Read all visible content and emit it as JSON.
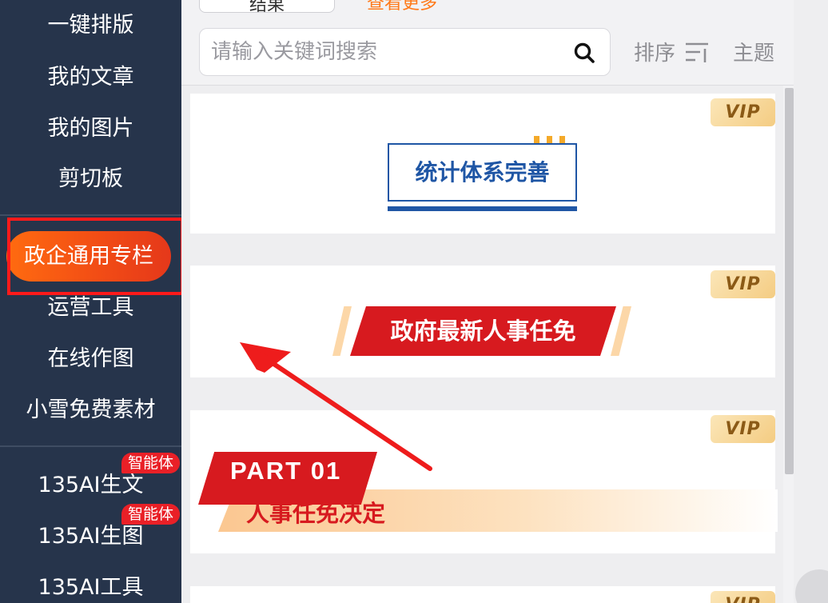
{
  "sidebar": {
    "items": [
      {
        "label": "一键排版"
      },
      {
        "label": "我的文章"
      },
      {
        "label": "我的图片"
      },
      {
        "label": "剪切板"
      },
      {
        "label": "政企通用专栏",
        "active": true
      },
      {
        "label": "运营工具"
      },
      {
        "label": "在线作图"
      },
      {
        "label": "小雪免费素材"
      },
      {
        "label": "135AI生文",
        "badge": "智能体"
      },
      {
        "label": "135AI生图",
        "badge": "智能体"
      },
      {
        "label": "135AI工具"
      }
    ]
  },
  "toolbar": {
    "top_button_partial": "结果",
    "top_link_partial": "查看更多",
    "search_placeholder": "请输入关键词搜索",
    "sort_label": "排序",
    "theme_label": "主题"
  },
  "cards": [
    {
      "title": "统计体系完善",
      "badge": "VIP"
    },
    {
      "title": "政府最新人事任免",
      "badge": "VIP"
    },
    {
      "part_label": "PART 01",
      "title": "人事任免决定",
      "badge": "VIP"
    },
    {
      "badge": "VIP"
    }
  ],
  "colors": {
    "sidebar_bg": "#26344b",
    "active_pill": "#f24d15",
    "highlight_border": "#ff1a1a",
    "badge_red": "#e92027",
    "card1_blue": "#1f56a5",
    "banner_red": "#d71a1f",
    "vip_gold": "#f4cc82"
  }
}
